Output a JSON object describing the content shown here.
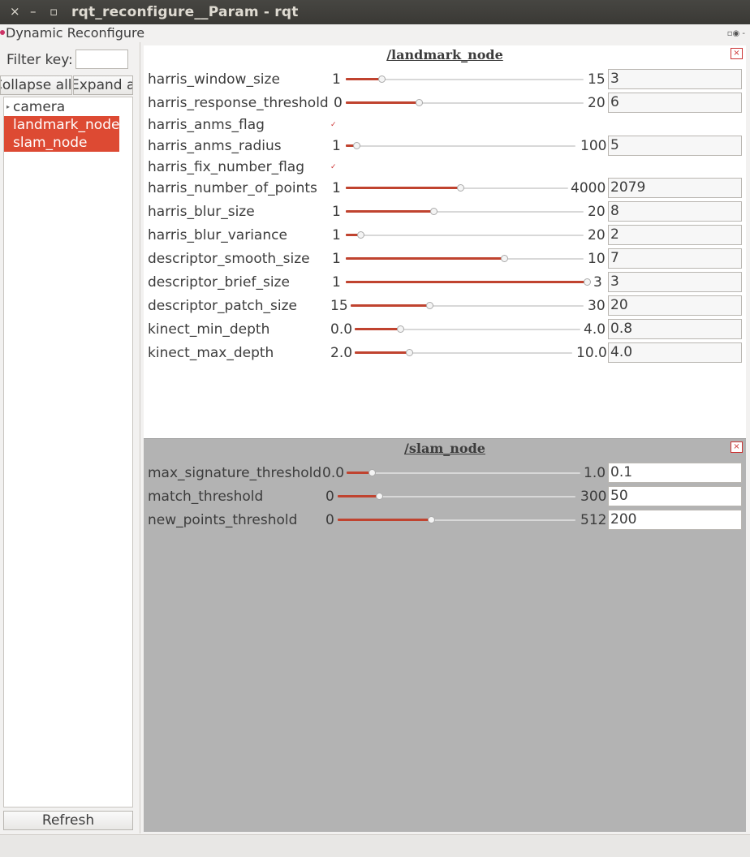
{
  "window": {
    "close_glyph": "×",
    "min_glyph": "–",
    "max_glyph": "▫",
    "title": "rqt_reconfigure__Param - rqt"
  },
  "plugin": {
    "title": "Dynamic Reconfigure",
    "controls": "▫◉ -"
  },
  "sidebar": {
    "filter_label": "Filter key:",
    "filter_value": "",
    "collapse_label": "Collapse all",
    "expand_label": "Expand all",
    "tree": [
      {
        "label": "camera",
        "selected": false,
        "expandable": true
      },
      {
        "label": "landmark_node",
        "selected": true,
        "expandable": false
      },
      {
        "label": "slam_node",
        "selected": true,
        "expandable": false
      }
    ],
    "refresh_label": "Refresh"
  },
  "panels": [
    {
      "title": "/landmark_node",
      "close_glyph": "×",
      "params": [
        {
          "name": "harris_window_size",
          "type": "slider",
          "min": "1",
          "max": "15",
          "value": "3"
        },
        {
          "name": "harris_response_threshold",
          "type": "slider",
          "min": "0",
          "max": "20",
          "value": "6"
        },
        {
          "name": "harris_anms_flag",
          "type": "bool",
          "checked": true
        },
        {
          "name": "harris_anms_radius",
          "type": "slider",
          "min": "1",
          "max": "100",
          "value": "5"
        },
        {
          "name": "harris_fix_number_flag",
          "type": "bool",
          "checked": true
        },
        {
          "name": "harris_number_of_points",
          "type": "slider",
          "min": "1",
          "max": "4000",
          "value": "2079"
        },
        {
          "name": "harris_blur_size",
          "type": "slider",
          "min": "1",
          "max": "20",
          "value": "8"
        },
        {
          "name": "harris_blur_variance",
          "type": "slider",
          "min": "1",
          "max": "20",
          "value": "2"
        },
        {
          "name": "descriptor_smooth_size",
          "type": "slider",
          "min": "1",
          "max": "10",
          "value": "7"
        },
        {
          "name": "descriptor_brief_size",
          "type": "slider",
          "min": "1",
          "max": "3",
          "value": "3"
        },
        {
          "name": "descriptor_patch_size",
          "type": "slider",
          "min": "15",
          "max": "30",
          "value": "20"
        },
        {
          "name": "kinect_min_depth",
          "type": "slider",
          "min": "0.0",
          "max": "4.0",
          "value": "0.8"
        },
        {
          "name": "kinect_max_depth",
          "type": "slider",
          "min": "2.0",
          "max": "10.0",
          "value": "4.0"
        }
      ]
    },
    {
      "title": "/slam_node",
      "close_glyph": "×",
      "params": [
        {
          "name": "max_signature_threshold",
          "type": "slider",
          "min": "0.0",
          "max": "1.0",
          "value": "0.1"
        },
        {
          "name": "match_threshold",
          "type": "slider",
          "min": "0",
          "max": "300",
          "value": "50"
        },
        {
          "name": "new_points_threshold",
          "type": "slider",
          "min": "0",
          "max": "512",
          "value": "200"
        }
      ]
    }
  ],
  "colors": {
    "accent": "#dd4a33",
    "slider_fill": "#c0432f",
    "titlebar": "#3c3b37"
  }
}
